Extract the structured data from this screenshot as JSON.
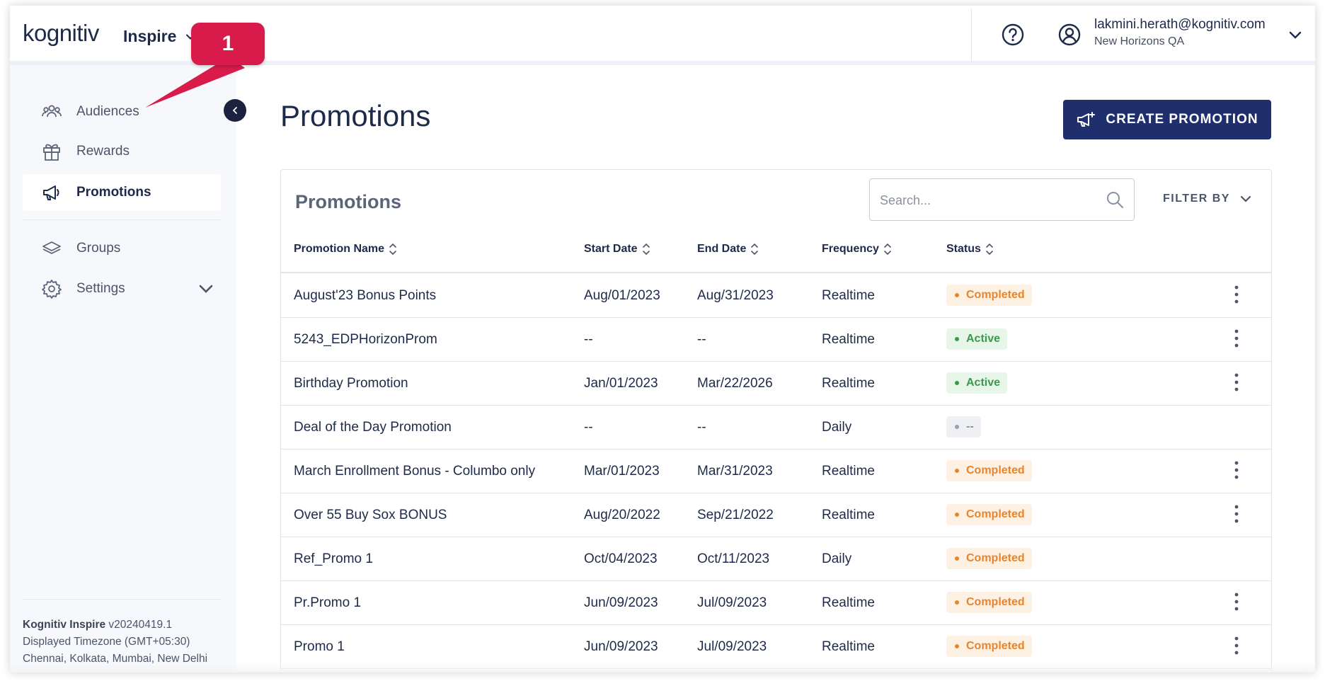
{
  "header": {
    "logo_main": "kognitiv",
    "app_name": "Inspire",
    "user_email": "lakmini.herath@kognitiv.com",
    "user_org": "New Horizons QA"
  },
  "sidebar": {
    "items": [
      {
        "label": "Audiences",
        "icon": "audiences-icon"
      },
      {
        "label": "Rewards",
        "icon": "gift-icon"
      },
      {
        "label": "Promotions",
        "icon": "megaphone-icon",
        "active": true
      },
      {
        "label": "Groups",
        "icon": "layers-icon"
      },
      {
        "label": "Settings",
        "icon": "gear-icon"
      }
    ],
    "footer": {
      "product": "Kognitiv Inspire",
      "version": " v20240419.1",
      "timezone_line1": "Displayed Timezone (GMT+05:30)",
      "timezone_line2": "Chennai, Kolkata, Mumbai, New Delhi"
    }
  },
  "main": {
    "page_title": "Promotions",
    "create_button": "CREATE PROMOTION",
    "card_title": "Promotions",
    "search_placeholder": "Search...",
    "filter_label": "FILTER BY",
    "columns": [
      "Promotion Name",
      "Start Date",
      "End Date",
      "Frequency",
      "Status"
    ],
    "rows": [
      {
        "name": "August'23 Bonus Points",
        "start": "Aug/01/2023",
        "end": "Aug/31/2023",
        "frequency": "Realtime",
        "status": "Completed",
        "status_type": "completed",
        "menu": true
      },
      {
        "name": "5243_EDPHorizonProm",
        "start": "--",
        "end": "--",
        "frequency": "Realtime",
        "status": "Active",
        "status_type": "active",
        "menu": true
      },
      {
        "name": "Birthday Promotion",
        "start": "Jan/01/2023",
        "end": "Mar/22/2026",
        "frequency": "Realtime",
        "status": "Active",
        "status_type": "active",
        "menu": true
      },
      {
        "name": "Deal of the Day Promotion",
        "start": "--",
        "end": "--",
        "frequency": "Daily",
        "status": "--",
        "status_type": "none",
        "menu": false
      },
      {
        "name": "March Enrollment Bonus - Columbo only",
        "start": "Mar/01/2023",
        "end": "Mar/31/2023",
        "frequency": "Realtime",
        "status": "Completed",
        "status_type": "completed",
        "menu": true
      },
      {
        "name": "Over 55 Buy Sox BONUS",
        "start": "Aug/20/2022",
        "end": "Sep/21/2022",
        "frequency": "Realtime",
        "status": "Completed",
        "status_type": "completed",
        "menu": true
      },
      {
        "name": "Ref_Promo 1",
        "start": "Oct/04/2023",
        "end": "Oct/11/2023",
        "frequency": "Daily",
        "status": "Completed",
        "status_type": "completed",
        "menu": false
      },
      {
        "name": "Pr.Promo 1",
        "start": "Jun/09/2023",
        "end": "Jul/09/2023",
        "frequency": "Realtime",
        "status": "Completed",
        "status_type": "completed",
        "menu": true
      },
      {
        "name": "Promo 1",
        "start": "Jun/09/2023",
        "end": "Jul/09/2023",
        "frequency": "Realtime",
        "status": "Completed",
        "status_type": "completed",
        "menu": true
      }
    ]
  },
  "annotation": {
    "callout_number": "1"
  },
  "colors": {
    "primary": "#1f2f6e",
    "brand_teal": "#19b3b6",
    "callout": "#d81b4a",
    "completed": "#e8842a",
    "active": "#3a9a4a"
  }
}
